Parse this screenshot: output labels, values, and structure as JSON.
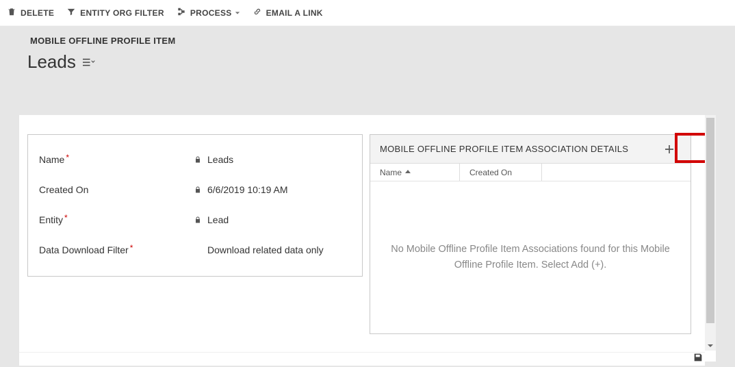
{
  "toolbar": {
    "delete": "DELETE",
    "entity_org_filter": "ENTITY ORG FILTER",
    "process": "PROCESS",
    "email_link": "EMAIL A LINK"
  },
  "breadcrumb": "MOBILE OFFLINE PROFILE ITEM",
  "title": "Leads",
  "form": {
    "name_label": "Name",
    "name_value": "Leads",
    "created_on_label": "Created On",
    "created_on_value": "6/6/2019  10:19 AM",
    "entity_label": "Entity",
    "entity_value": "Lead",
    "data_download_filter_label": "Data Download Filter",
    "data_download_filter_value": "Download related data only"
  },
  "assoc": {
    "title": "MOBILE OFFLINE PROFILE ITEM ASSOCIATION DETAILS",
    "col_name": "Name",
    "col_created_on": "Created On",
    "empty": "No Mobile Offline Profile Item Associations found for this Mobile Offline Profile Item. Select Add (+)."
  }
}
